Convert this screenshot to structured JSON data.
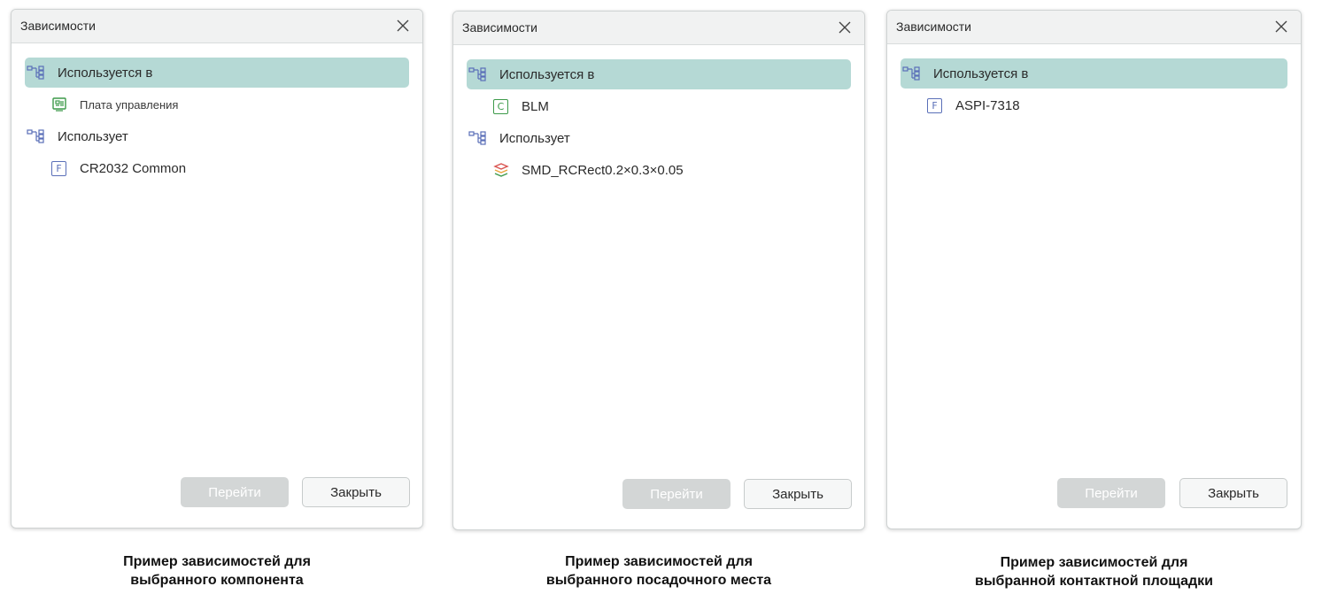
{
  "panels": [
    {
      "title": "Зависимости",
      "close_icon": "close-icon",
      "tree": [
        {
          "type": "group",
          "label": "Используется в",
          "icon": "dependency-tree-icon",
          "selected": true
        },
        {
          "type": "child",
          "label": "Плата управления",
          "icon": "board-icon",
          "small": true
        },
        {
          "type": "group",
          "label": "Использует",
          "icon": "dependency-tree-icon",
          "selected": false
        },
        {
          "type": "child",
          "label": "CR2032 Common",
          "icon": "footprint-f-icon",
          "letter": "F"
        }
      ],
      "buttons": {
        "go": "Перейти",
        "close": "Закрыть"
      }
    },
    {
      "title": "Зависимости",
      "close_icon": "close-icon",
      "tree": [
        {
          "type": "group",
          "label": "Используется в",
          "icon": "dependency-tree-icon",
          "selected": true
        },
        {
          "type": "child",
          "label": "BLM",
          "icon": "component-c-icon",
          "letter": "C"
        },
        {
          "type": "group",
          "label": "Использует",
          "icon": "dependency-tree-icon",
          "selected": false
        },
        {
          "type": "child",
          "label": "SMD_RCRect0.2×0.3×0.05",
          "icon": "pad-stack-icon"
        }
      ],
      "buttons": {
        "go": "Перейти",
        "close": "Закрыть"
      }
    },
    {
      "title": "Зависимости",
      "close_icon": "close-icon",
      "tree": [
        {
          "type": "group",
          "label": "Используется в",
          "icon": "dependency-tree-icon",
          "selected": true
        },
        {
          "type": "child",
          "label": "ASPI-7318",
          "icon": "footprint-f-icon",
          "letter": "F"
        }
      ],
      "buttons": {
        "go": "Перейти",
        "close": "Закрыть"
      }
    }
  ],
  "captions": [
    {
      "line1": "Пример зависимостей для",
      "line2": "выбранного компонента"
    },
    {
      "line1": "Пример зависимостей для",
      "line2": "выбранного посадочного места"
    },
    {
      "line1": "Пример зависимостей для",
      "line2": "выбранной контактной площадки"
    }
  ],
  "colors": {
    "selected_row": "#b5d9d5",
    "footprint_icon": "#5a6fb8",
    "component_icon": "#3d9a4a",
    "disabled_button": "#d3d6d6"
  }
}
